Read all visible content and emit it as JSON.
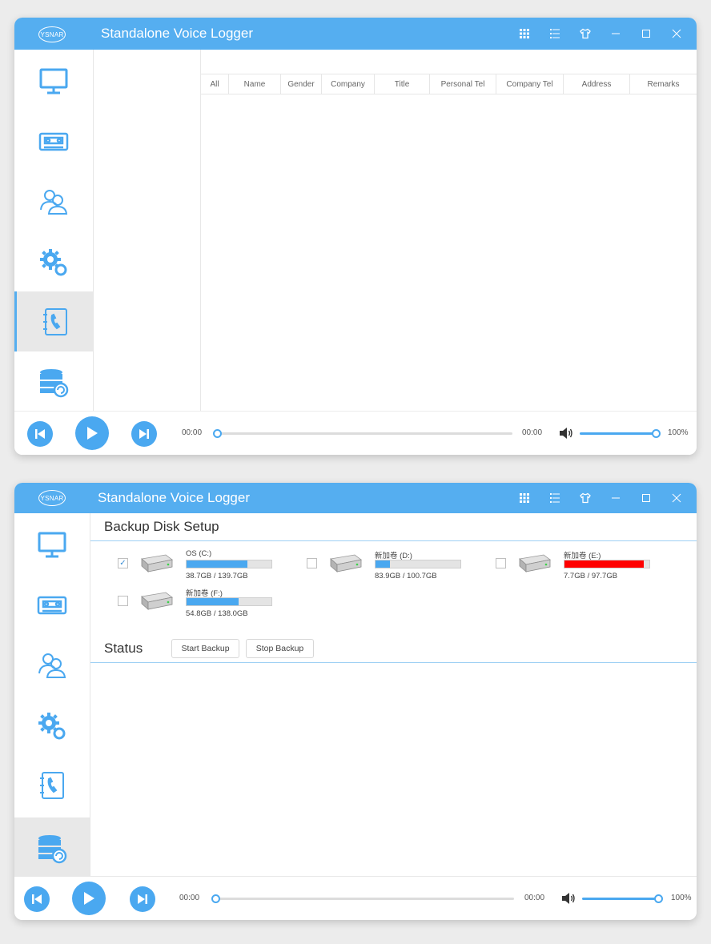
{
  "app": {
    "title": "Standalone Voice Logger",
    "logo_text": "YSNAR"
  },
  "colors": {
    "accent": "#55aef0",
    "bar_normal": "#4aa8f0",
    "bar_critical": "#ff0000"
  },
  "titlebar_icons": [
    "grid-icon",
    "list-icon",
    "shirt-icon",
    "minimize-icon",
    "maximize-icon",
    "close-icon"
  ],
  "sidebar_items": [
    "monitor-icon",
    "tape-recorder-icon",
    "contacts-icon",
    "settings-gears-icon",
    "phonebook-icon",
    "database-backup-icon"
  ],
  "window1": {
    "active_nav": "phonebook",
    "columns": [
      "All",
      "Name",
      "Gender",
      "Company",
      "Title",
      "Personal Tel",
      "Company Tel",
      "Address",
      "Remarks"
    ]
  },
  "window2": {
    "active_nav": "database-backup",
    "backup_title": "Backup Disk Setup",
    "status_title": "Status",
    "start_backup": "Start Backup",
    "stop_backup": "Stop Backup",
    "disks": [
      {
        "name": "OS (C:)",
        "size": "38.7GB / 139.7GB",
        "checked": true,
        "checkmark": "✓",
        "used_fraction": 0.72,
        "color": "#4aa8f0"
      },
      {
        "name": "新加卷 (D:)",
        "size": "83.9GB / 100.7GB",
        "checked": false,
        "checkmark": "",
        "used_fraction": 0.17,
        "color": "#4aa8f0"
      },
      {
        "name": "新加卷 (E:)",
        "size": "7.7GB / 97.7GB",
        "checked": false,
        "checkmark": "",
        "used_fraction": 0.93,
        "color": "#ff0000"
      },
      {
        "name": "新加卷 (F:)",
        "size": "54.8GB / 138.0GB",
        "checked": false,
        "checkmark": "",
        "used_fraction": 0.61,
        "color": "#4aa8f0"
      }
    ]
  },
  "player": {
    "time_start": "00:00",
    "time_end": "00:00",
    "volume": "100%",
    "progress": 0,
    "volume_level": 1.0
  }
}
